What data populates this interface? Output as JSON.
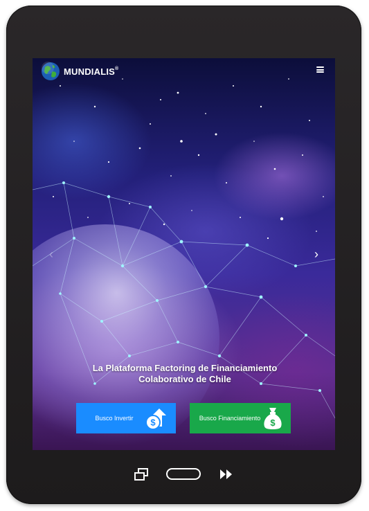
{
  "header": {
    "brand_name": "MUNDIALIS",
    "brand_mark": "®",
    "menu_icon": "hamburger-menu-icon",
    "logo_icon": "globe-icon"
  },
  "hero": {
    "tagline_line1": "La Plataforma Factoring de Financiamiento",
    "tagline_line2": "Colaborativo de Chile",
    "prev_icon": "chevron-left-icon",
    "next_icon": "chevron-right-icon"
  },
  "buttons": {
    "invest_label": "Busco Invertir",
    "invest_icon": "dollar-coin-up-arrow-icon",
    "finance_label": "Busco Financiamiento",
    "finance_icon": "money-bag-icon"
  },
  "device_nav": {
    "recent_icon": "recent-apps-icon",
    "home_icon": "home-button-icon",
    "forward_icon": "fast-forward-icon"
  },
  "colors": {
    "invest_button": "#1a8cff",
    "finance_button": "#19a84a",
    "device_frame": "#231f20"
  }
}
